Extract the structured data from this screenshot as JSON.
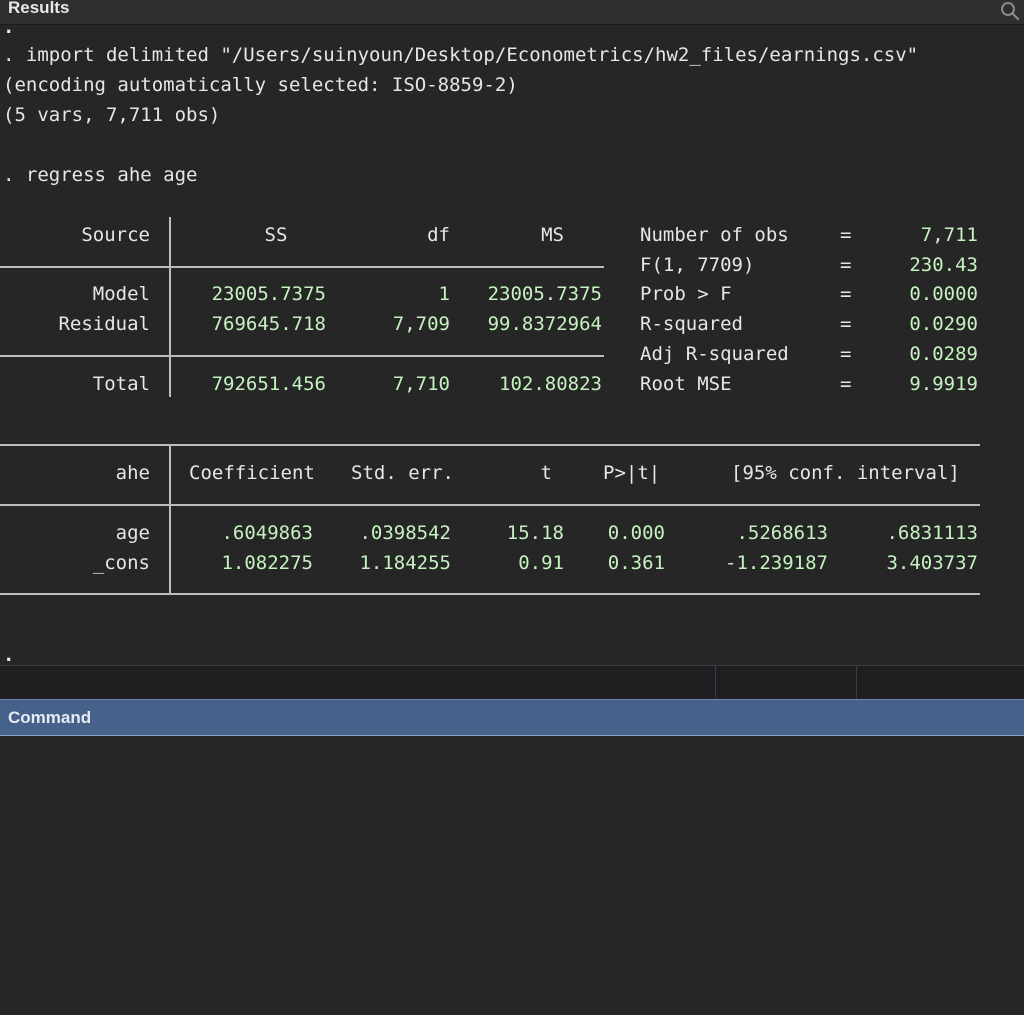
{
  "results_pane": {
    "title": "Results",
    "top_prompt": ".",
    "log": {
      "import_cmd": ". import delimited \"/Users/suinyoun/Desktop/Econometrics/hw2_files/earnings.csv\"",
      "encoding_line": "(encoding automatically selected: ISO-8859-2)",
      "vars_line": "(5 vars, 7,711 obs)",
      "regress_cmd": ". regress ahe age"
    },
    "anova": {
      "headers": {
        "source": "Source",
        "ss": "SS",
        "df": "df",
        "ms": "MS"
      },
      "rows": [
        {
          "source": "Model",
          "ss": "23005.7375",
          "df": "1",
          "ms": "23005.7375"
        },
        {
          "source": "Residual",
          "ss": "769645.718",
          "df": "7,709",
          "ms": "99.8372964"
        },
        {
          "source": "Total",
          "ss": "792651.456",
          "df": "7,710",
          "ms": "102.80823"
        }
      ]
    },
    "stats": [
      {
        "label": "Number of obs",
        "eq": "=",
        "value": "7,711"
      },
      {
        "label": "F(1, 7709)",
        "eq": "=",
        "value": "230.43"
      },
      {
        "label": "Prob > F",
        "eq": "=",
        "value": "0.0000"
      },
      {
        "label": "R-squared",
        "eq": "=",
        "value": "0.0290"
      },
      {
        "label": "Adj R-squared",
        "eq": "=",
        "value": "0.0289"
      },
      {
        "label": "Root MSE",
        "eq": "=",
        "value": "9.9919"
      }
    ],
    "coef_table": {
      "headers": {
        "depvar": "ahe",
        "coef": "Coefficient",
        "se": "Std. err.",
        "t": "t",
        "p": "P>|t|",
        "ci": "[95% conf. interval]"
      },
      "rows": [
        {
          "var": "age",
          "coef": ".6049863",
          "se": ".0398542",
          "t": "15.18",
          "p": "0.000",
          "ci_low": ".5268613",
          "ci_high": ".6831113"
        },
        {
          "var": "_cons",
          "coef": "1.082275",
          "se": "1.184255",
          "t": "0.91",
          "p": "0.361",
          "ci_low": "-1.239187",
          "ci_high": "3.403737"
        }
      ]
    },
    "bottom_prompt": "."
  },
  "command_pane": {
    "title": "Command",
    "input_value": ""
  },
  "icons": {
    "search": "search-icon"
  },
  "colors": {
    "background": "#262626",
    "header_blue": "#46628a",
    "result_green": "#c5f3bf",
    "text": "#e6e6e6"
  }
}
